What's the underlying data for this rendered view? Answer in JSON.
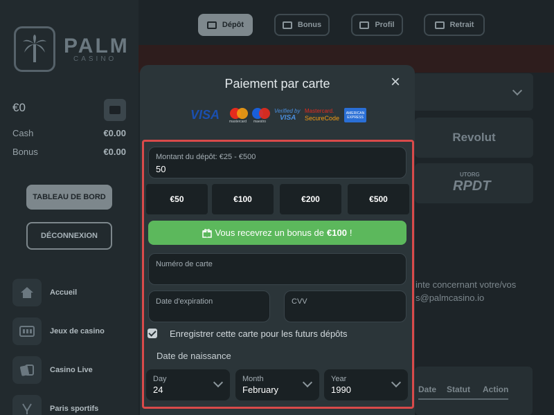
{
  "brand": {
    "name": "PALM",
    "sub": "CASINO"
  },
  "sidebar": {
    "balance": "€0",
    "cash_label": "Cash",
    "cash_value": "€0.00",
    "bonus_label": "Bonus",
    "bonus_value": "€0.00",
    "dashboard_btn": "TABLEAU DE BORD",
    "logout_btn": "DÉCONNEXION",
    "nav": [
      {
        "label": "Accueil",
        "icon": "home-icon"
      },
      {
        "label": "Jeux de casino",
        "icon": "slot-machine-icon"
      },
      {
        "label": "Casino Live",
        "icon": "cards-icon"
      },
      {
        "label": "Paris sportifs",
        "icon": "sports-icon"
      }
    ]
  },
  "topnav": [
    {
      "label": "Dépôt",
      "active": true
    },
    {
      "label": "Bonus",
      "active": false
    },
    {
      "label": "Profil",
      "active": false
    },
    {
      "label": "Retrait",
      "active": false
    }
  ],
  "background": {
    "provider_1": "Revolut",
    "provider_2_small": "UTORG",
    "provider_2": "RPDT",
    "contact_line1": "inte concernant votre/vos",
    "contact_line2": "s@palmcasino.io",
    "table_headers": [
      "Date",
      "Statut",
      "Action"
    ]
  },
  "modal": {
    "title": "Paiement par carte",
    "close": "×",
    "card_brands": {
      "visa": "VISA",
      "mastercard": "mastercard",
      "maestro": "maestro",
      "verified_by": "Verified by",
      "verified_visa": "VISA",
      "mc_secure_1": "Mastercard.",
      "mc_secure_2": "SecureCode",
      "amex": "AMERICAN EXPRESS"
    },
    "amount_label": "Montant du dépôt: €25 - €500",
    "amount_value": "50",
    "quick_amounts": [
      "€50",
      "€100",
      "€200",
      "€500"
    ],
    "bonus_prefix": "Vous recevrez un bonus de",
    "bonus_amount": "€100",
    "bonus_suffix": "!",
    "card_number_label": "Numéro de carte",
    "expiry_label": "Date d'expiration",
    "cvv_label": "CVV",
    "save_card_label": "Enregistrer cette carte pour les futurs dépôts",
    "save_card_checked": true,
    "dob_label": "Date de naissance",
    "day_label": "Day",
    "day_value": "24",
    "month_label": "Month",
    "month_value": "February",
    "year_label": "Year",
    "year_value": "1990"
  },
  "colors": {
    "accent_green": "#5cb85c",
    "highlight_red": "#d94a4a",
    "bg": "#1d2428"
  }
}
